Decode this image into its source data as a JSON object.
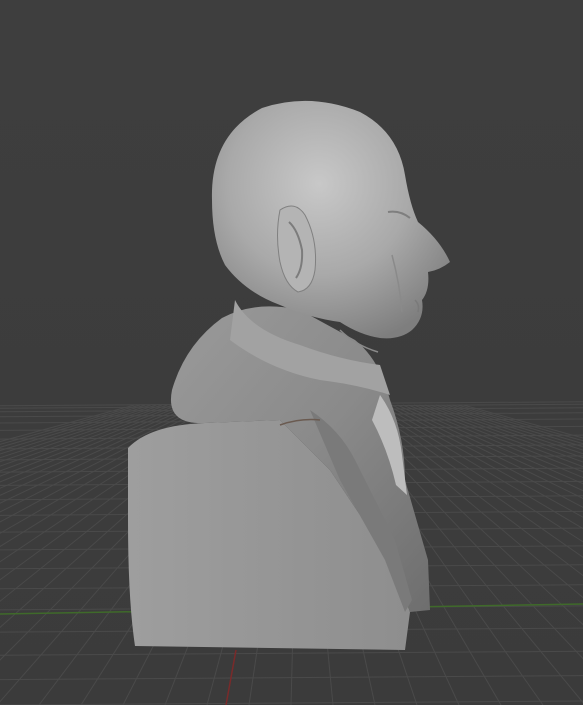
{
  "viewport": {
    "background_color": "#3d3d3d",
    "grid_color": "#4a4a4a",
    "x_axis_color": "#7a2a2a",
    "y_axis_color": "#3f6a2a",
    "view": "perspective",
    "model": "bust",
    "model_color": "#9c9c9c",
    "model_shading": "solid"
  }
}
